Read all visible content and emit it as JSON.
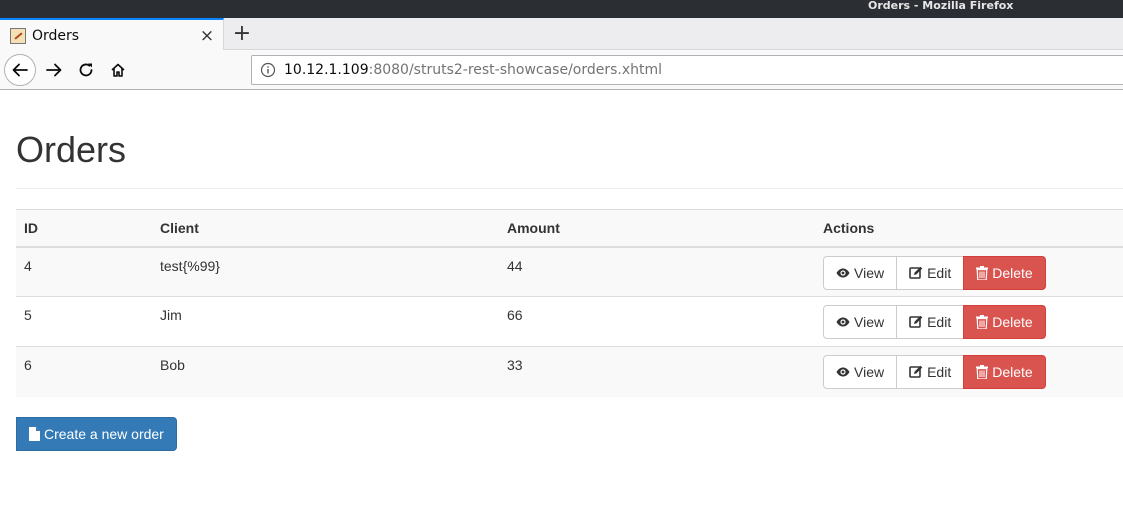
{
  "window": {
    "title": "Orders - Mozilla Firefox"
  },
  "tab": {
    "title": "Orders",
    "close": "×",
    "new_tab": "+"
  },
  "url": {
    "host": "10.12.1.109",
    "rest": ":8080/struts2-rest-showcase/orders.xhtml"
  },
  "page": {
    "title": "Orders"
  },
  "table": {
    "headers": {
      "id": "ID",
      "client": "Client",
      "amount": "Amount",
      "actions": "Actions"
    },
    "rows": [
      {
        "id": "4",
        "client": "test{%99}",
        "amount": "44"
      },
      {
        "id": "5",
        "client": "Jim",
        "amount": "66"
      },
      {
        "id": "6",
        "client": "Bob",
        "amount": "33"
      }
    ]
  },
  "actions": {
    "view": "View",
    "edit": "Edit",
    "delete": "Delete"
  },
  "create_button": "Create a new order",
  "colors": {
    "primary": "#337ab7",
    "danger": "#d9534f",
    "tab_accent": "#0a84ff"
  },
  "icons": [
    "back-arrow-icon",
    "forward-arrow-icon",
    "reload-icon",
    "home-icon",
    "info-icon",
    "eye-icon",
    "edit-icon",
    "trash-icon",
    "file-icon"
  ]
}
